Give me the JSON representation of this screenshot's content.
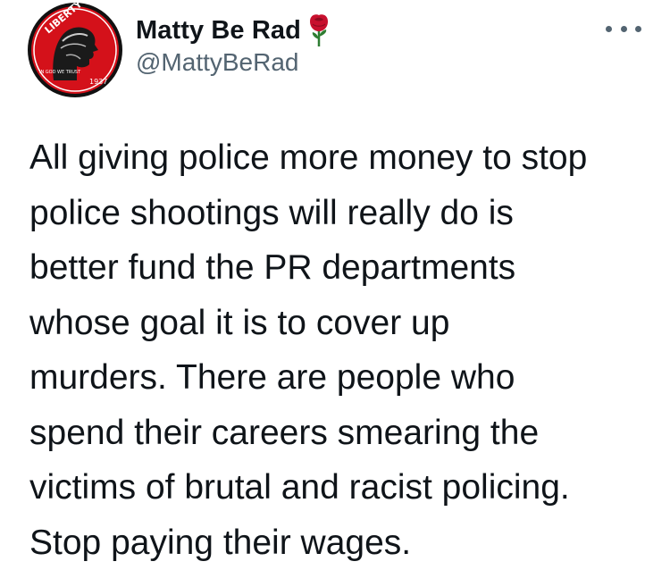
{
  "tweet": {
    "author": {
      "display_name": "Matty Be Rad",
      "handle": "@MattyBeRad",
      "name_emoji": "rose-icon",
      "avatar": {
        "description_icon": "liberty-dime-avatar-icon",
        "text_liberty": "LIBERTY",
        "text_year": "1937",
        "text_trust": "IN GOD WE TRUST"
      }
    },
    "more_icon": "more-horizontal-icon",
    "text": "All giving police more money to stop\npolice shootings will really do is\nbetter fund the PR departments\nwhose goal it is to cover up\nmurders. There are people who\nspend their careers smearing the\nvictims of brutal and racist policing.\nStop paying their wages."
  },
  "colors": {
    "text_primary": "#0f1419",
    "text_secondary": "#536471",
    "avatar_red": "#d4111a",
    "rose_red": "#c8102e",
    "rose_green": "#2e7d32"
  }
}
